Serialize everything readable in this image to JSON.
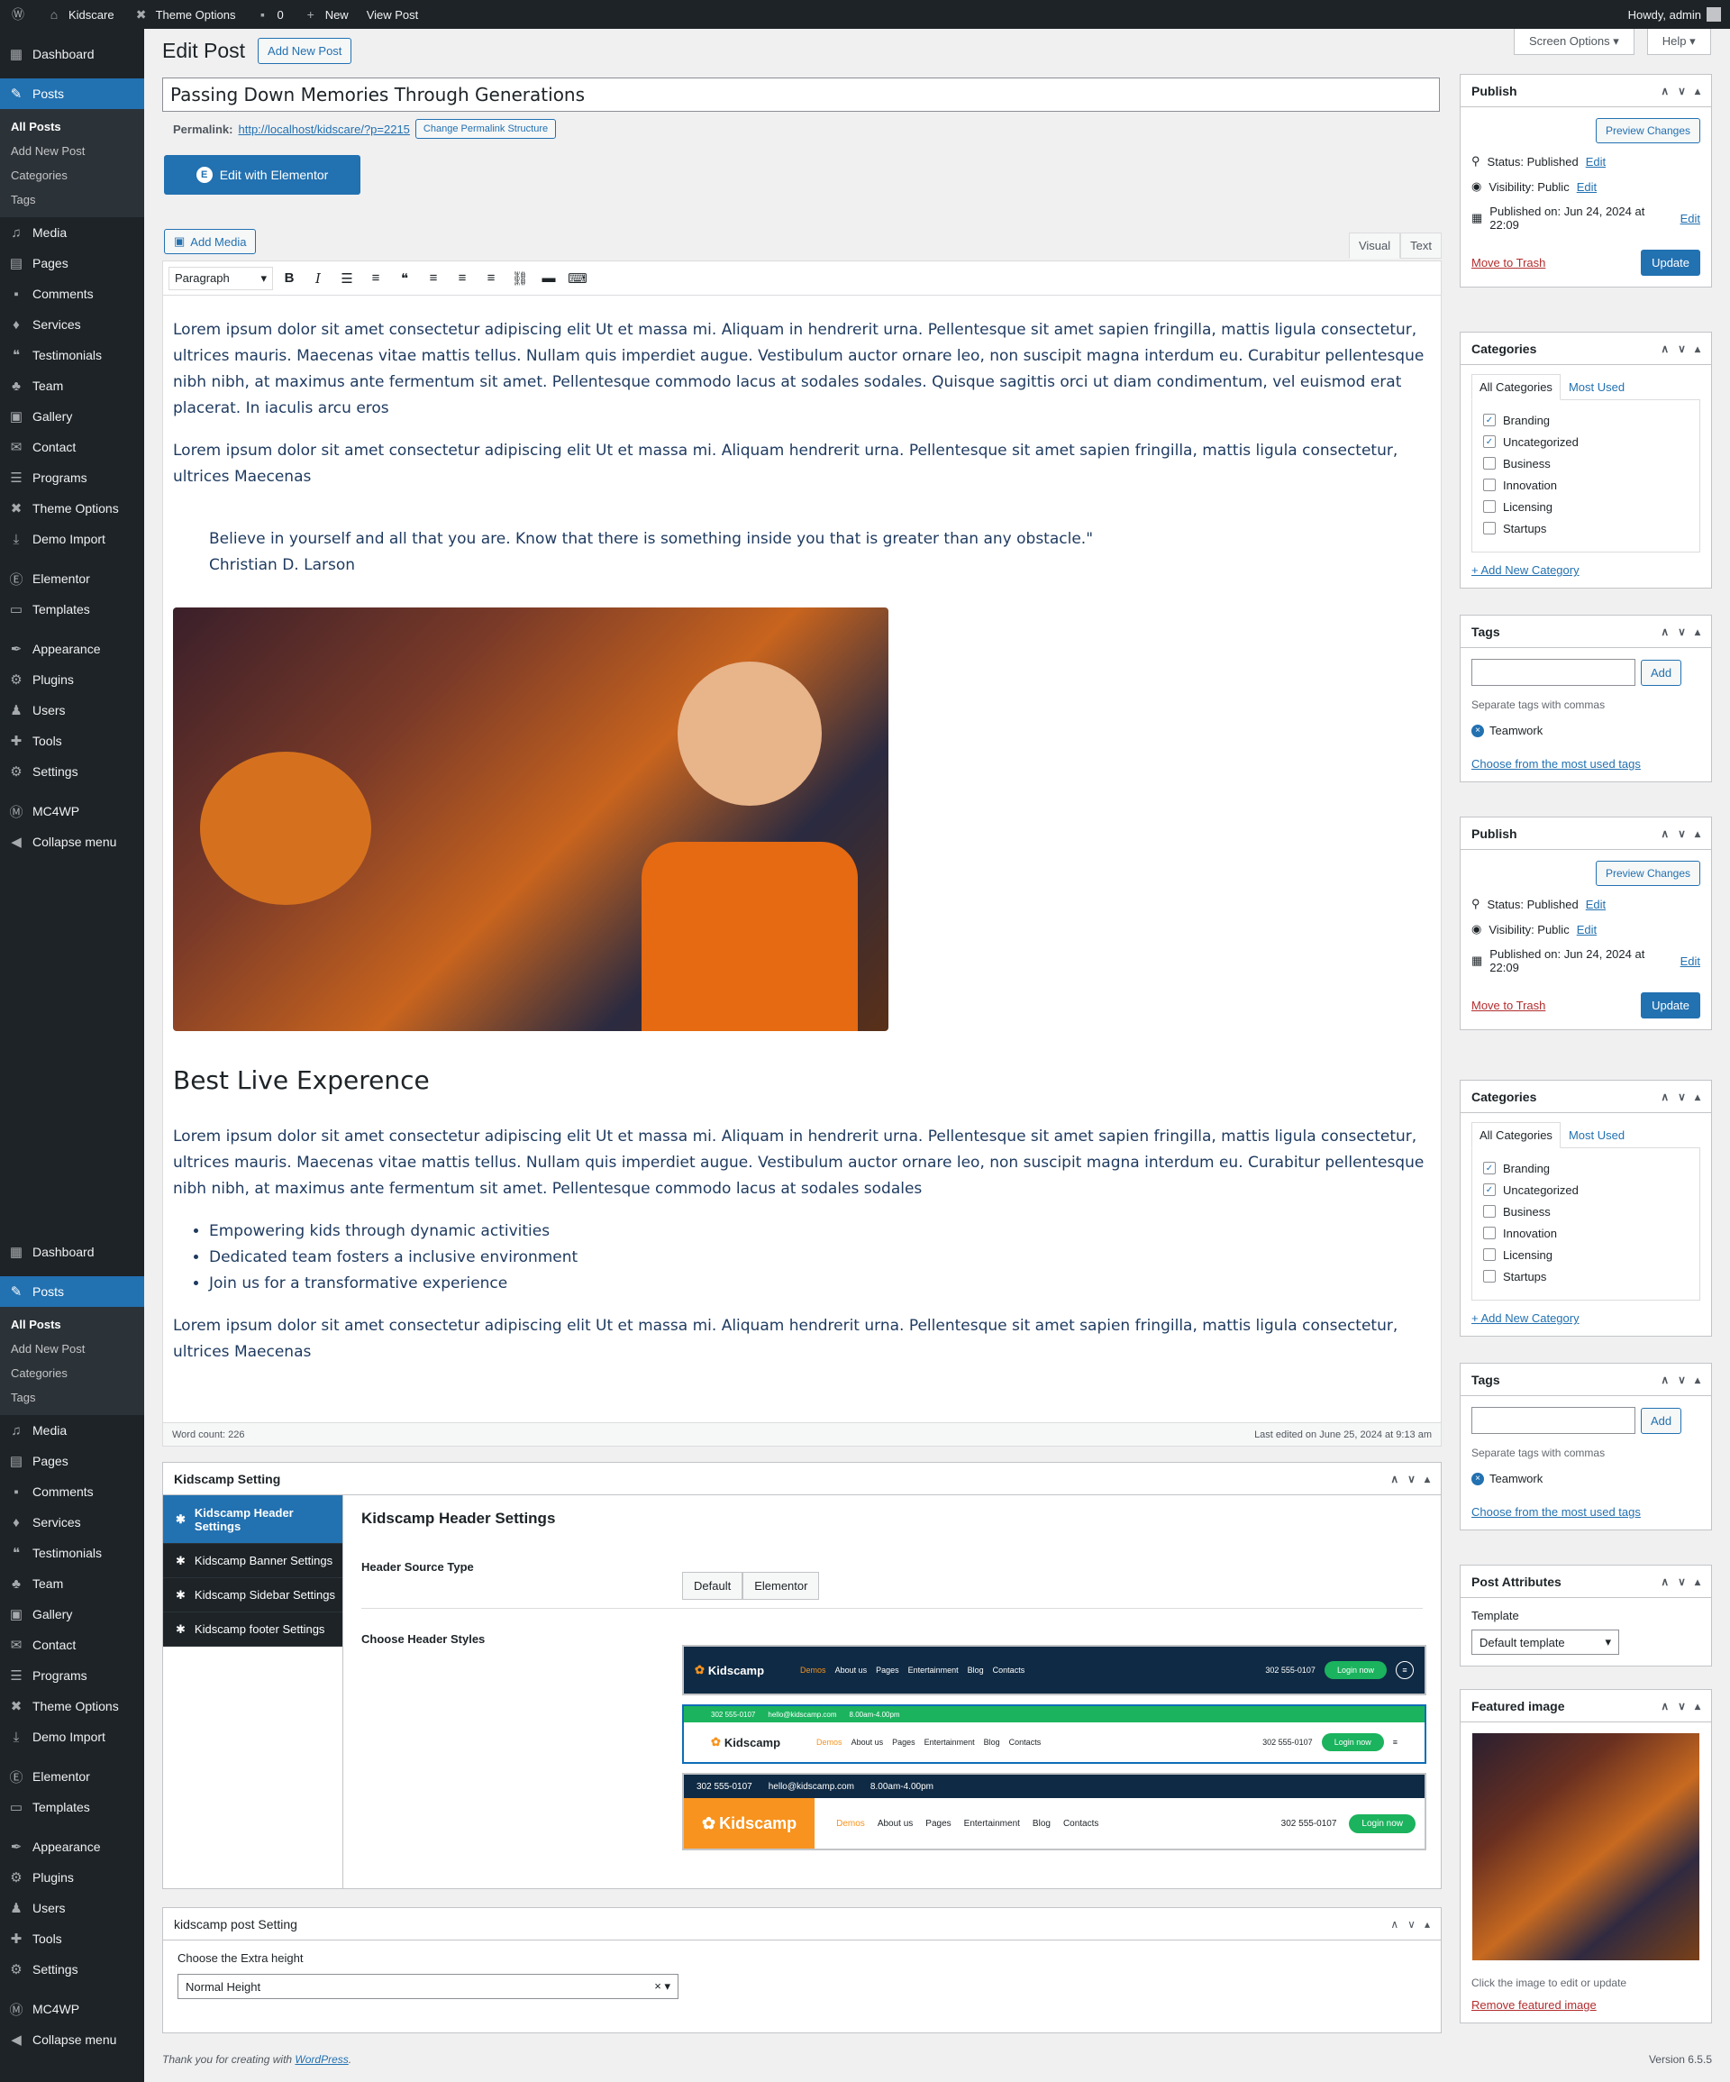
{
  "adminbar": {
    "site": "Kidscare",
    "theme_options": "Theme Options",
    "comments": "0",
    "new": "New",
    "view": "View Post",
    "howdy": "Howdy, admin"
  },
  "menu": {
    "items": [
      "Dashboard",
      "Posts",
      "Media",
      "Pages",
      "Comments",
      "Services",
      "Testimonials",
      "Team",
      "Gallery",
      "Contact",
      "Programs",
      "Theme Options",
      "Demo Import",
      "Elementor",
      "Templates",
      "Appearance",
      "Plugins",
      "Users",
      "Tools",
      "Settings",
      "MC4WP"
    ],
    "sub": [
      "All Posts",
      "Add New Post",
      "Categories",
      "Tags"
    ],
    "collapse": "Collapse menu"
  },
  "page": {
    "title": "Edit Post",
    "add_new": "Add New Post",
    "post_title": "Passing Down Memories Through Generations",
    "permalink_label": "Permalink:",
    "permalink_url": "http://localhost/kidscare/?p=2215",
    "change_perma": "Change Permalink Structure",
    "edit_elementor": "Edit with Elementor",
    "add_media": "Add Media",
    "tab_visual": "Visual",
    "tab_text": "Text",
    "format": "Paragraph"
  },
  "content": {
    "p1": "Lorem ipsum dolor sit amet consectetur adipiscing elit Ut et massa mi. Aliquam in hendrerit urna. Pellentesque sit amet sapien fringilla, mattis ligula consectetur, ultrices mauris. Maecenas vitae mattis tellus. Nullam quis imperdiet augue. Vestibulum auctor ornare leo, non suscipit magna interdum eu. Curabitur pellentesque nibh nibh, at maximus ante fermentum sit amet. Pellentesque commodo lacus at sodales sodales. Quisque sagittis orci ut diam condimentum, vel euismod erat placerat. In iaculis arcu eros",
    "p2": "Lorem ipsum dolor sit amet consectetur adipiscing elit Ut et massa mi. Aliquam hendrerit urna. Pellentesque sit amet sapien fringilla, mattis ligula consectetur, ultrices Maecenas",
    "quote": "Believe in yourself and all that you are. Know that there is something inside you that is greater than any obstacle.\"",
    "author": "Christian D. Larson",
    "h2": "Best Live Experence",
    "p3": "Lorem ipsum dolor sit amet consectetur adipiscing elit Ut et massa mi. Aliquam in hendrerit urna. Pellentesque sit amet sapien fringilla, mattis ligula consectetur, ultrices mauris. Maecenas vitae mattis tellus. Nullam quis imperdiet augue. Vestibulum auctor ornare leo, non suscipit magna interdum eu. Curabitur pellentesque nibh nibh, at maximus ante fermentum sit amet. Pellentesque commodo lacus at sodales sodales",
    "li": [
      "Empowering kids through dynamic activities",
      "Dedicated team fosters a inclusive environment",
      "Join us for a transformative experience"
    ],
    "p4": "Lorem ipsum dolor sit amet consectetur adipiscing elit Ut et massa mi. Aliquam hendrerit urna. Pellentesque sit amet sapien fringilla, mattis ligula consectetur, ultrices Maecenas",
    "word_count": "Word count: 226",
    "last_edited": "Last edited on June 25, 2024 at 9:13 am"
  },
  "kidscamp": {
    "title": "Kidscamp Setting",
    "nav": [
      "Kidscamp Header Settings",
      "Kidscamp Banner Settings",
      "Kidscamp Sidebar Settings",
      "Kidscamp footer Settings"
    ],
    "heading": "Kidscamp Header Settings",
    "source_label": "Header Source Type",
    "opt_default": "Default",
    "opt_elementor": "Elementor",
    "styles_label": "Choose Header Styles",
    "brand": "Kidscamp",
    "nav_demo": "Demos",
    "nav_about": "About us",
    "nav_pages": "Pages",
    "nav_ent": "Entertainment",
    "nav_blog": "Blog",
    "nav_contacts": "Contacts",
    "phone": "302 555-0107",
    "login": "Login now",
    "email": "hello@kidscamp.com",
    "hours": "8.00am-4.00pm"
  },
  "kpost": {
    "title": "kidscamp post Setting",
    "label": "Choose the Extra height",
    "value": "Normal Height"
  },
  "footer": {
    "thanks": "Thank you for creating with",
    "wp": "WordPress",
    "version": "Version 6.5.5"
  },
  "side": {
    "screen_options": "Screen Options",
    "help": "Help",
    "publish": "Publish",
    "preview": "Preview Changes",
    "status": "Status: Published",
    "visibility": "Visibility: Public",
    "published_on": "Published on: Jun 24, 2024 at 22:09",
    "edit": "Edit",
    "trash": "Move to Trash",
    "update": "Update",
    "categories": "Categories",
    "all_cat": "All Categories",
    "most_used": "Most Used",
    "cats": [
      "Branding",
      "Uncategorized",
      "Business",
      "Innovation",
      "Licensing",
      "Startups"
    ],
    "add_cat": "+ Add New Category",
    "tags": "Tags",
    "add": "Add",
    "sep_tags": "Separate tags with commas",
    "tag": "Teamwork",
    "choose_tags": "Choose from the most used tags",
    "attributes": "Post Attributes",
    "template": "Template",
    "template_val": "Default template",
    "featured": "Featured image",
    "feat_hint": "Click the image to edit or update",
    "remove_feat": "Remove featured image"
  }
}
